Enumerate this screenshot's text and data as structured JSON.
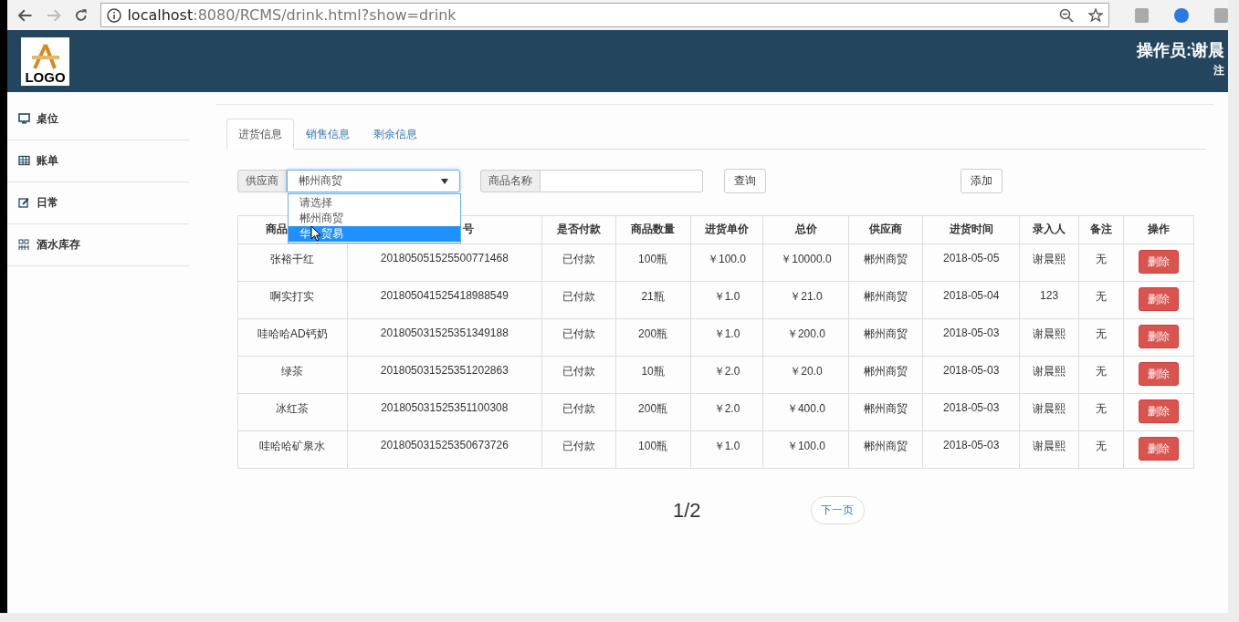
{
  "browser": {
    "url_host": "localhost",
    "url_rest": ":8080/RCMS/drink.html?show=drink"
  },
  "header": {
    "logo_text": "LOGO",
    "operator": "操作员:谢晨",
    "logout": "注"
  },
  "sidebar": {
    "items": [
      {
        "label": "桌位",
        "kind": "monitor"
      },
      {
        "label": "账单",
        "kind": "table"
      },
      {
        "label": "日常",
        "kind": "edit"
      },
      {
        "label": "酒水库存",
        "kind": "grid"
      }
    ]
  },
  "tabs": [
    {
      "label": "进货信息",
      "selected": true
    },
    {
      "label": "销售信息",
      "selected": false
    },
    {
      "label": "剩余信息",
      "selected": false
    }
  ],
  "filters": {
    "supplier_label": "供应商",
    "supplier_value": "郴州商贸",
    "options": [
      {
        "label_parts": [
          "请选择"
        ],
        "selected": false
      },
      {
        "label_parts": [
          "郴州商贸"
        ],
        "selected": false
      },
      {
        "label_parts": [
          "华",
          "贸易"
        ],
        "selected": true
      }
    ],
    "name_label": "商品名称",
    "query_button": "查询",
    "add_button": "添加"
  },
  "table": {
    "columns": [
      "商品",
      "号",
      "是否付款",
      "商品数量",
      "进货单价",
      "总价",
      "供应商",
      "进货时间",
      "录入人",
      "备注",
      "操作"
    ],
    "rows": [
      {
        "cells": [
          "张裕干红",
          "201805051525500771468",
          "已付款",
          "100瓶",
          "￥100.0",
          "￥10000.0",
          "郴州商贸",
          "2018-05-05",
          "谢晨熙",
          "无"
        ],
        "action": "删除"
      },
      {
        "cells": [
          "啊实打实",
          "201805041525418988549",
          "已付款",
          "21瓶",
          "￥1.0",
          "￥21.0",
          "郴州商贸",
          "2018-05-04",
          "123",
          "无"
        ],
        "action": "删除"
      },
      {
        "cells": [
          "哇哈哈AD钙奶",
          "201805031525351349188",
          "已付款",
          "200瓶",
          "￥1.0",
          "￥200.0",
          "郴州商贸",
          "2018-05-03",
          "谢晨熙",
          "无"
        ],
        "action": "删除"
      },
      {
        "cells": [
          "绿茶",
          "201805031525351202863",
          "已付款",
          "10瓶",
          "￥2.0",
          "￥20.0",
          "郴州商贸",
          "2018-05-03",
          "谢晨熙",
          "无"
        ],
        "action": "删除"
      },
      {
        "cells": [
          "冰红茶",
          "201805031525351100308",
          "已付款",
          "200瓶",
          "￥2.0",
          "￥400.0",
          "郴州商贸",
          "2018-05-03",
          "谢晨熙",
          "无"
        ],
        "action": "删除"
      },
      {
        "cells": [
          "哇哈哈矿泉水",
          "201805031525350673726",
          "已付款",
          "100瓶",
          "￥1.0",
          "￥100.0",
          "郴州商贸",
          "2018-05-03",
          "谢晨熙",
          "无"
        ],
        "action": "删除"
      }
    ]
  },
  "pager": {
    "page": "1/2",
    "next": "下一页"
  }
}
